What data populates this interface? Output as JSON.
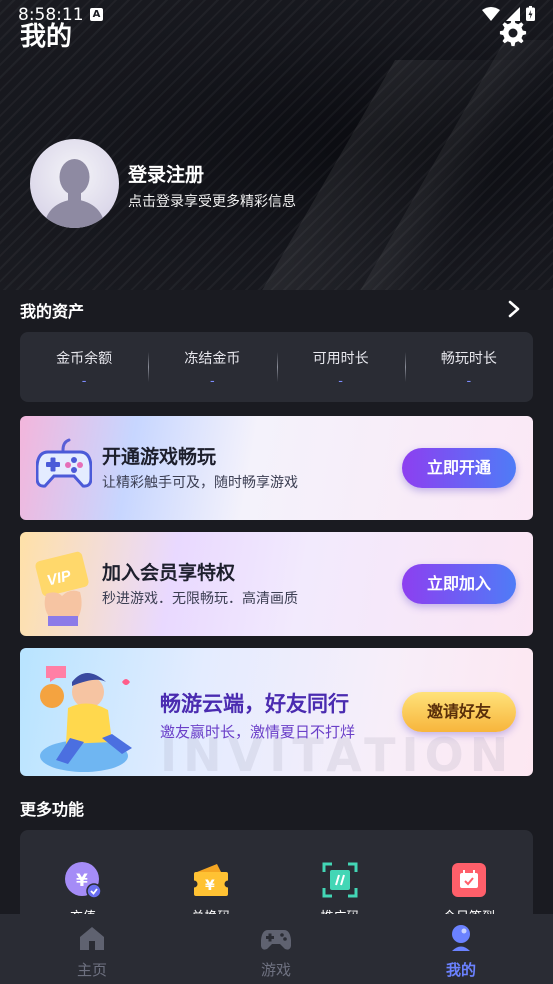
{
  "status_bar": {
    "time": "8:58:11",
    "notification_badge": "A"
  },
  "header": {
    "title": "我的"
  },
  "profile": {
    "title": "登录注册",
    "subtitle": "点击登录享受更多精彩信息"
  },
  "assets": {
    "title": "我的资产",
    "items": [
      {
        "label": "金币余额",
        "value": "-"
      },
      {
        "label": "冻结金币",
        "value": "-"
      },
      {
        "label": "可用时长",
        "value": "-"
      },
      {
        "label": "畅玩时长",
        "value": "-"
      }
    ]
  },
  "banners": [
    {
      "title": "开通游戏畅玩",
      "subtitle": "让精彩触手可及，随时畅享游戏",
      "button": "立即开通"
    },
    {
      "title": "加入会员享特权",
      "subtitle": "秒进游戏．无限畅玩．高清画质",
      "button": "立即加入",
      "badge": "VIP"
    },
    {
      "title": "畅游云端，好友同行",
      "subtitle": "邀友赢时长，激情夏日不打烊",
      "button": "邀请好友",
      "watermark": "INVITATION"
    }
  ],
  "more": {
    "title": "更多功能",
    "items": [
      {
        "label": "充值",
        "icon": "coin-recharge-icon"
      },
      {
        "label": "兑换码",
        "icon": "ticket-icon"
      },
      {
        "label": "推广码",
        "icon": "scan-code-icon"
      },
      {
        "label": "今日签到",
        "icon": "calendar-checkin-icon"
      }
    ]
  },
  "tabbar": {
    "items": [
      {
        "label": "主页",
        "icon": "home-icon"
      },
      {
        "label": "游戏",
        "icon": "gamepad-icon"
      },
      {
        "label": "我的",
        "icon": "profile-icon",
        "active": true
      }
    ]
  },
  "colors": {
    "background": "#1a1b21",
    "card": "#2a2c34",
    "accent": "#6b82ff",
    "button_gradient": [
      "#8d3ff0",
      "#4f7cf7"
    ]
  }
}
